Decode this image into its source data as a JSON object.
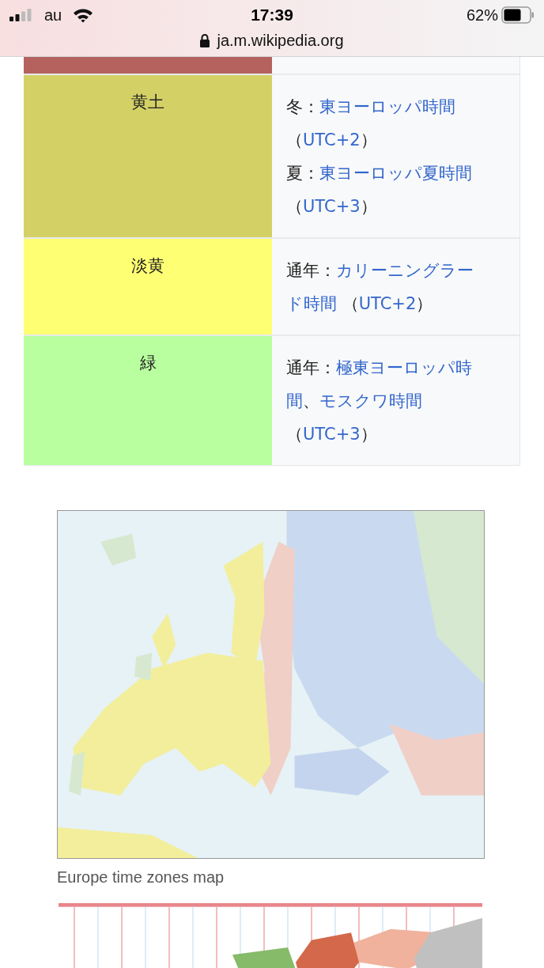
{
  "status_bar": {
    "carrier": "au",
    "time": "17:39",
    "battery": "62%"
  },
  "address_bar": {
    "url": "ja.m.wikipedia.org"
  },
  "table": {
    "rows": [
      {
        "color": "#b5625f",
        "lines": []
      },
      {
        "label": "黄土",
        "color": "#d3d166",
        "lines": [
          [
            {
              "kind": "text",
              "text": "冬："
            },
            {
              "kind": "link",
              "text": "東ヨーロッパ時間"
            }
          ],
          [
            {
              "kind": "text",
              "text": "（"
            },
            {
              "kind": "link",
              "text": "UTC+2"
            },
            {
              "kind": "text",
              "text": "）"
            }
          ],
          [
            {
              "kind": "text",
              "text": "夏："
            },
            {
              "kind": "link",
              "text": "東ヨーロッパ夏時間"
            }
          ],
          [
            {
              "kind": "text",
              "text": "（"
            },
            {
              "kind": "link",
              "text": "UTC+3"
            },
            {
              "kind": "text",
              "text": "）"
            }
          ]
        ]
      },
      {
        "label": "淡黄",
        "color": "#ffff73",
        "lines": [
          [
            {
              "kind": "text",
              "text": "通年："
            },
            {
              "kind": "link",
              "text": "カリーニングラー"
            }
          ],
          [
            {
              "kind": "link",
              "text": "ド時間"
            },
            {
              "kind": "text",
              "text": " （"
            },
            {
              "kind": "link",
              "text": "UTC+2"
            },
            {
              "kind": "text",
              "text": "）"
            }
          ]
        ]
      },
      {
        "label": "緑",
        "color": "#b9ff9f",
        "lines": [
          [
            {
              "kind": "text",
              "text": "通年："
            },
            {
              "kind": "link",
              "text": "極東ヨーロッパ時"
            }
          ],
          [
            {
              "kind": "link",
              "text": "間"
            },
            {
              "kind": "text",
              "text": "、"
            },
            {
              "kind": "link",
              "text": "モスクワ時間"
            }
          ],
          [
            {
              "kind": "text",
              "text": "（"
            },
            {
              "kind": "link",
              "text": "UTC+3"
            },
            {
              "kind": "text",
              "text": "）"
            }
          ]
        ]
      }
    ]
  },
  "figures": [
    {
      "kind": "picture",
      "caption": "Europe time zones map"
    },
    {
      "kind": "picture"
    }
  ]
}
